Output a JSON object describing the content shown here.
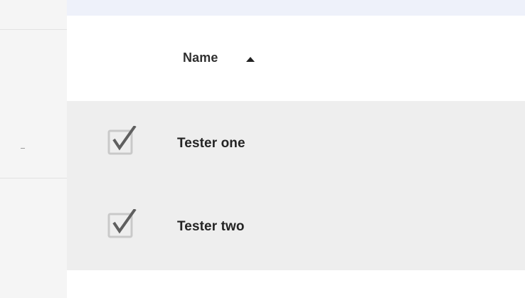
{
  "table": {
    "header": {
      "column_label": "Name",
      "sort_direction": "ascending",
      "sort_icon": "sort-ascending-arrow"
    },
    "rows": [
      {
        "label": "Tester one",
        "checked": true
      },
      {
        "label": "Tester two",
        "checked": true
      }
    ]
  },
  "colors": {
    "sidebar_background": "#f5f5f5",
    "top_strip_background": "#eef1fa",
    "row_background": "#eeeeee",
    "checkbox_border": "#c9c9c9",
    "checkmark": "#5f5f5f",
    "text": "#242424"
  }
}
